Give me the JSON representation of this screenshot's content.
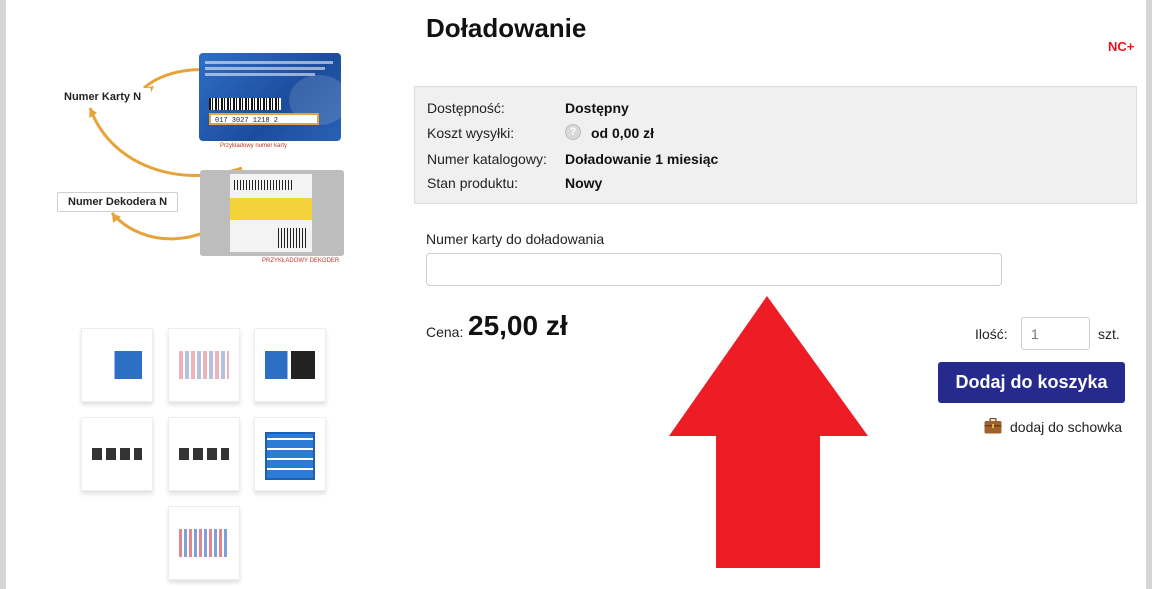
{
  "product": {
    "title": "Doładowanie",
    "brand": "NC+"
  },
  "illustration": {
    "card_callout": "Numer Karty N",
    "decoder_callout": "Numer Dekodera N",
    "card_number": "017 3027 1218 2",
    "card_caption": "Przykładowy numer karty",
    "decoder_caption": "PRZYKŁADOWY DEKODER"
  },
  "thumbnails": [
    {
      "name": "thumb-1",
      "icon": "card-and-decoder"
    },
    {
      "name": "thumb-2",
      "icon": "channel-grid"
    },
    {
      "name": "thumb-3",
      "icon": "card-and-decoder-dark"
    },
    {
      "name": "thumb-4",
      "icon": "devices"
    },
    {
      "name": "thumb-5",
      "icon": "devices"
    },
    {
      "name": "thumb-6",
      "icon": "channel-board"
    },
    {
      "name": "thumb-7",
      "icon": "channel-tiles"
    }
  ],
  "details": [
    {
      "label": "Dostępność:",
      "value": "Dostępny"
    },
    {
      "label": "Koszt wysyłki:",
      "value": "od 0,00 zł",
      "icon": "help-icon"
    },
    {
      "label": "Numer katalogowy:",
      "value": "Doładowanie 1 miesiąc"
    },
    {
      "label": "Stan produktu:",
      "value": "Nowy"
    }
  ],
  "card_field": {
    "label": "Numer karty do doładowania",
    "value": ""
  },
  "price": {
    "label": "Cena:",
    "value": "25,00 zł"
  },
  "quantity": {
    "label": "Ilość:",
    "value": "1",
    "unit": "szt."
  },
  "actions": {
    "add_to_cart": "Dodaj do koszyka",
    "add_to_clipboard": "dodaj do schowka",
    "clipboard_icon": "briefcase-icon"
  },
  "colors": {
    "accent_button": "#262a8c",
    "brand_red": "#e3141d",
    "overlay_arrow": "#ee1c25"
  }
}
